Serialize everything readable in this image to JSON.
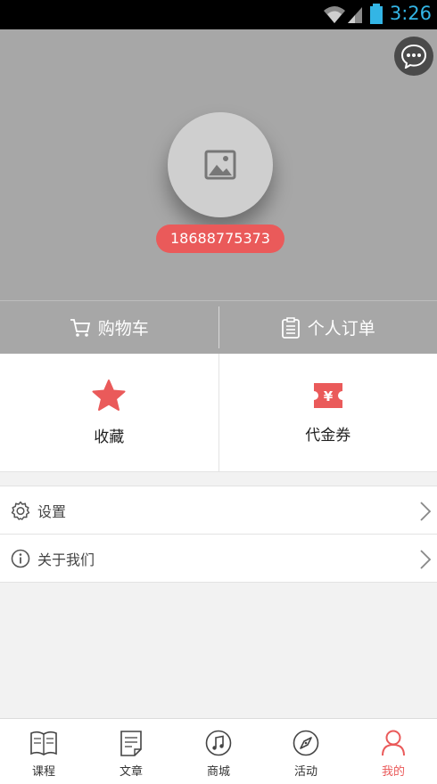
{
  "status_bar": {
    "time": "3:26"
  },
  "header": {
    "phone": "18688775373"
  },
  "actions": [
    {
      "label": "购物车"
    },
    {
      "label": "个人订单"
    }
  ],
  "grid": [
    {
      "label": "收藏"
    },
    {
      "label": "代金券"
    }
  ],
  "menu": [
    {
      "label": "设置"
    },
    {
      "label": "关于我们"
    }
  ],
  "tabs": [
    {
      "label": "课程"
    },
    {
      "label": "文章"
    },
    {
      "label": "商城"
    },
    {
      "label": "活动"
    },
    {
      "label": "我的"
    }
  ],
  "colors": {
    "accent": "#ea5a5a",
    "header_bg": "#a7a7a7",
    "statusbar_time": "#33b5e5"
  }
}
